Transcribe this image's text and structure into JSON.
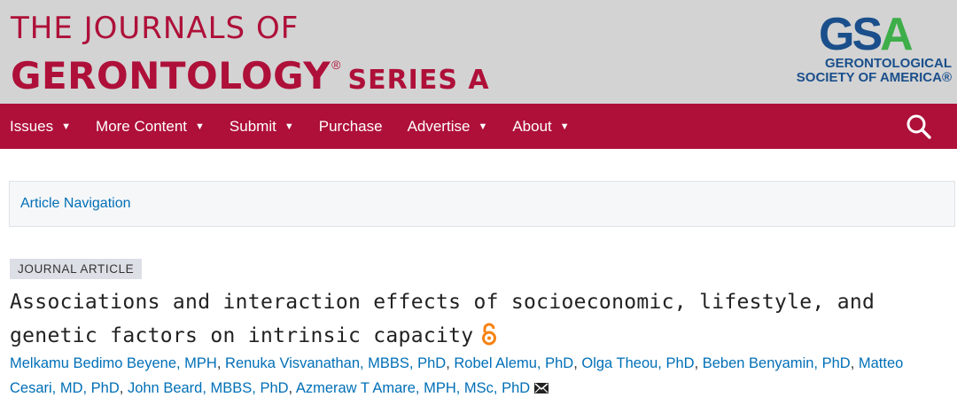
{
  "header": {
    "journal_line1": "THE JOURNALS OF",
    "journal_line2": "GERONTOLOGY",
    "registered_mark": "®",
    "series": "SERIES A",
    "society_logo_letters": "GSA",
    "society_line1": "GERONTOLOGICAL",
    "society_line2": "SOCIETY OF AMERICA®"
  },
  "nav": {
    "items": [
      {
        "label": "Issues",
        "dropdown": true
      },
      {
        "label": "More Content",
        "dropdown": true
      },
      {
        "label": "Submit",
        "dropdown": true
      },
      {
        "label": "Purchase",
        "dropdown": false
      },
      {
        "label": "Advertise",
        "dropdown": true
      },
      {
        "label": "About",
        "dropdown": true
      }
    ],
    "caret": "▼",
    "search_icon": "search-icon"
  },
  "article_navigation": {
    "label": "Article Navigation"
  },
  "article": {
    "type_badge": "JOURNAL ARTICLE",
    "title": "Associations and interaction effects of socioeconomic, lifestyle, and genetic factors on intrinsic capacity",
    "open_access_icon": "open-access-icon",
    "authors": [
      "Melkamu Bedimo Beyene, MPH",
      "Renuka Visvanathan, MBBS, PhD",
      "Robel Alemu, PhD",
      "Olga Theou, PhD",
      "Beben Benyamin, PhD",
      "Matteo Cesari, MD, PhD",
      "John Beard, MBBS, PhD",
      "Azmeraw T Amare, MPH, MSc, PhD"
    ],
    "author_separator": ", ",
    "contact_icon": "envelope-icon"
  },
  "colors": {
    "brand_red": "#ae1039",
    "header_gray": "#d3d3d3",
    "link_blue": "#006fb7",
    "gsa_blue": "#1a4f8b",
    "gsa_green": "#3dae49",
    "oa_orange": "#f68212"
  }
}
